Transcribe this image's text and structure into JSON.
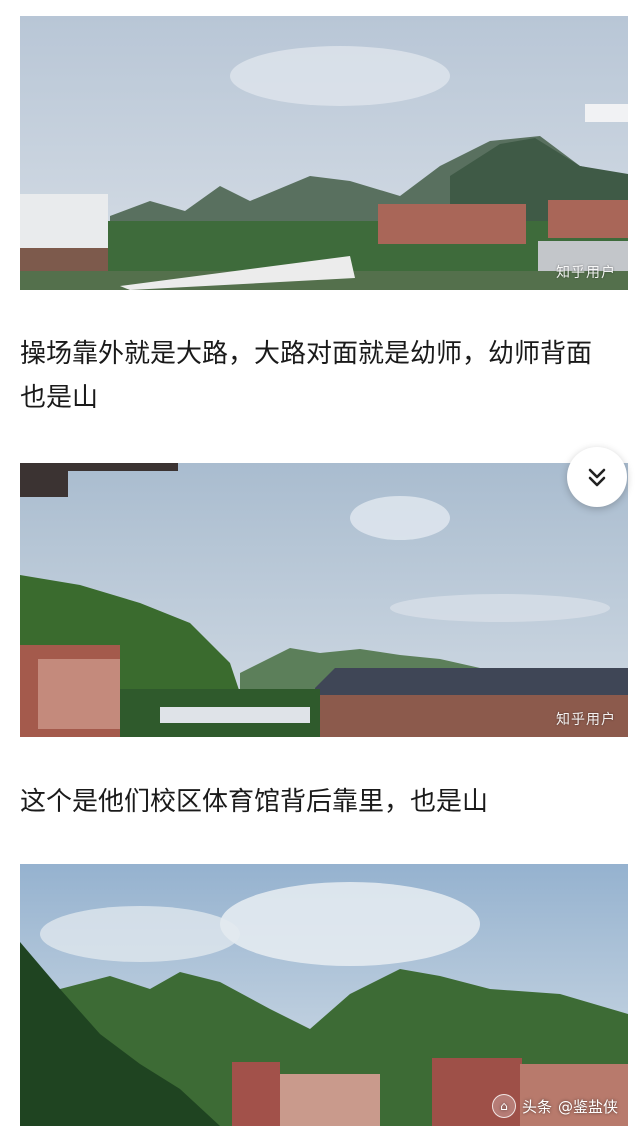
{
  "photos": [
    {
      "watermark": "知乎用户"
    },
    {
      "watermark": "知乎用户"
    },
    {
      "watermark": ""
    }
  ],
  "captions": [
    "操场靠外就是大路，大路对面就是幼师，幼师背面也是山",
    "这个是他们校区体育馆背后靠里，也是山"
  ],
  "expand_button": {
    "icon": "double-chevron-down-icon"
  },
  "author_badge": {
    "platform": "头条",
    "handle": "@鉴盐侠",
    "icon": "toutiao-logo-icon"
  },
  "colors": {
    "caption_text": "#1a1a1a",
    "background": "#ffffff"
  }
}
